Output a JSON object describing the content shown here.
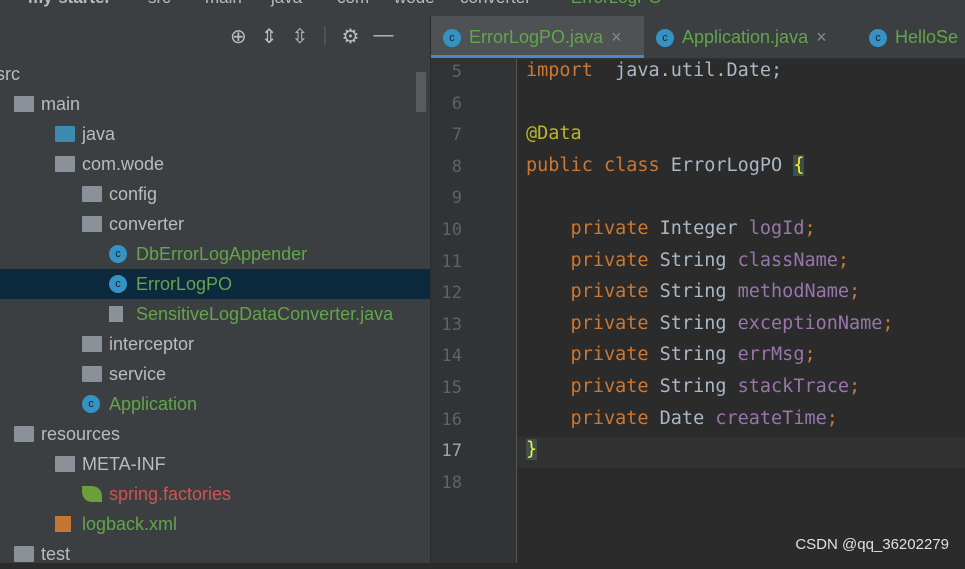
{
  "breadcrumb": [
    "my-starter",
    "src",
    "main",
    "java",
    "com",
    "wode",
    "converter",
    "ErrorLogPO"
  ],
  "toolbar": {
    "icons": [
      "locate-icon",
      "expand-all-icon",
      "collapse-all-icon",
      "gear-icon",
      "minimize-icon"
    ]
  },
  "tree": [
    {
      "label": "src",
      "depth": 0,
      "chev": "",
      "icon": "none",
      "color": "#bbbbbb"
    },
    {
      "label": "main",
      "depth": 0,
      "chev": "",
      "icon": "folder",
      "color": "#bbbbbb"
    },
    {
      "label": "java",
      "depth": 1,
      "chev": "",
      "icon": "folder-blue",
      "color": "#bbbbbb"
    },
    {
      "label": "com.wode",
      "depth": 1,
      "chev": "v",
      "icon": "package",
      "color": "#bbbbbb"
    },
    {
      "label": "config",
      "depth": 2,
      "chev": ">",
      "icon": "package",
      "color": "#bbbbbb"
    },
    {
      "label": "converter",
      "depth": 2,
      "chev": "v",
      "icon": "package",
      "color": "#bbbbbb"
    },
    {
      "label": "DbErrorLogAppender",
      "depth": 3,
      "chev": "",
      "icon": "class",
      "color": "#62a54a"
    },
    {
      "label": "ErrorLogPO",
      "depth": 3,
      "chev": "",
      "icon": "class",
      "color": "#62a54a",
      "selected": true
    },
    {
      "label": "SensitiveLogDataConverter.java",
      "depth": 3,
      "chev": "",
      "icon": "java-file",
      "color": "#62a54a"
    },
    {
      "label": "interceptor",
      "depth": 2,
      "chev": ">",
      "icon": "package",
      "color": "#bbbbbb"
    },
    {
      "label": "service",
      "depth": 2,
      "chev": ">",
      "icon": "package",
      "color": "#bbbbbb"
    },
    {
      "label": "Application",
      "depth": 2,
      "chev": "",
      "icon": "spring-class",
      "color": "#62a54a"
    },
    {
      "label": "resources",
      "depth": 0,
      "chev": "",
      "icon": "folder",
      "color": "#bbbbbb"
    },
    {
      "label": "META-INF",
      "depth": 1,
      "chev": "v",
      "icon": "folder",
      "color": "#bbbbbb"
    },
    {
      "label": "spring.factories",
      "depth": 2,
      "chev": "",
      "icon": "spring-leaf",
      "color": "#d25252"
    },
    {
      "label": "logback.xml",
      "depth": 1,
      "chev": "",
      "icon": "xml-file",
      "color": "#62a54a"
    },
    {
      "label": "test",
      "depth": 0,
      "chev": "",
      "icon": "folder",
      "color": "#bbbbbb"
    }
  ],
  "tabs": [
    {
      "label": "ErrorLogPO.java",
      "active": true
    },
    {
      "label": "Application.java"
    },
    {
      "label": "HelloSe"
    }
  ],
  "code": [
    {
      "n": 5,
      "parts": [
        [
          "kw",
          "import"
        ],
        [
          "",
          "  java.util.Date;"
        ]
      ]
    },
    {
      "n": 6,
      "parts": []
    },
    {
      "n": 7,
      "parts": [
        [
          "an",
          "@Data"
        ]
      ]
    },
    {
      "n": 8,
      "parts": [
        [
          "kw",
          "public class "
        ],
        [
          "",
          "ErrorLogPO "
        ],
        [
          "brace",
          "{"
        ]
      ]
    },
    {
      "n": 9,
      "parts": []
    },
    {
      "n": 10,
      "parts": [
        [
          "kw",
          "    private "
        ],
        [
          "",
          "Integer "
        ],
        [
          "fd",
          "logId"
        ],
        [
          "kw",
          ";"
        ]
      ]
    },
    {
      "n": 11,
      "parts": [
        [
          "kw",
          "    private "
        ],
        [
          "",
          "String "
        ],
        [
          "fd",
          "className"
        ],
        [
          "kw",
          ";"
        ]
      ]
    },
    {
      "n": 12,
      "parts": [
        [
          "kw",
          "    private "
        ],
        [
          "",
          "String "
        ],
        [
          "fd",
          "methodName"
        ],
        [
          "kw",
          ";"
        ]
      ]
    },
    {
      "n": 13,
      "parts": [
        [
          "kw",
          "    private "
        ],
        [
          "",
          "String "
        ],
        [
          "fd",
          "exceptionName"
        ],
        [
          "kw",
          ";"
        ]
      ]
    },
    {
      "n": 14,
      "parts": [
        [
          "kw",
          "    private "
        ],
        [
          "",
          "String "
        ],
        [
          "fd",
          "errMsg"
        ],
        [
          "kw",
          ";"
        ]
      ]
    },
    {
      "n": 15,
      "parts": [
        [
          "kw",
          "    private "
        ],
        [
          "",
          "String "
        ],
        [
          "fd",
          "stackTrace"
        ],
        [
          "kw",
          ";"
        ]
      ]
    },
    {
      "n": 16,
      "parts": [
        [
          "kw",
          "    private "
        ],
        [
          "",
          "Date "
        ],
        [
          "fd",
          "createTime"
        ],
        [
          "kw",
          ";"
        ]
      ]
    },
    {
      "n": 17,
      "parts": [
        [
          "brace",
          "}"
        ]
      ],
      "current": true
    },
    {
      "n": 18,
      "parts": []
    }
  ],
  "watermark": "CSDN @qq_36202279"
}
